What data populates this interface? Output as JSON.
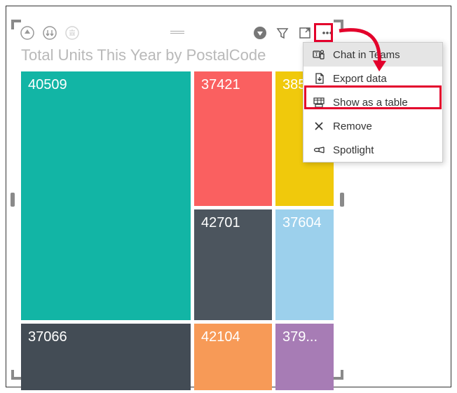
{
  "chart_data": {
    "type": "treemap",
    "title": "Total Units This Year by PostalCode",
    "series": [
      {
        "name": "tiles",
        "values": [
          {
            "label": "40509",
            "color": "#12b5a5"
          },
          {
            "label": "37066",
            "color": "#434c55"
          },
          {
            "label": "37421",
            "color": "#fa6060"
          },
          {
            "label": "38501",
            "color": "#f0c90c"
          },
          {
            "label": "42701",
            "color": "#4c555e"
          },
          {
            "label": "37604",
            "color": "#9cd0ec"
          },
          {
            "label": "42104",
            "color": "#f79a57"
          },
          {
            "label": "379...",
            "color": "#a77cb5"
          }
        ]
      }
    ]
  },
  "title": "Total Units This Year by PostalCode",
  "tiles": {
    "t40509": "40509",
    "t37066": "37066",
    "t37421": "37421",
    "t38501": "38501",
    "t42701": "42701",
    "t37604": "37604",
    "t42104": "42104",
    "t379": "379..."
  },
  "menu": {
    "chat": "Chat in Teams",
    "export": "Export data",
    "showtable": "Show as a table",
    "remove": "Remove",
    "spotlight": "Spotlight"
  }
}
